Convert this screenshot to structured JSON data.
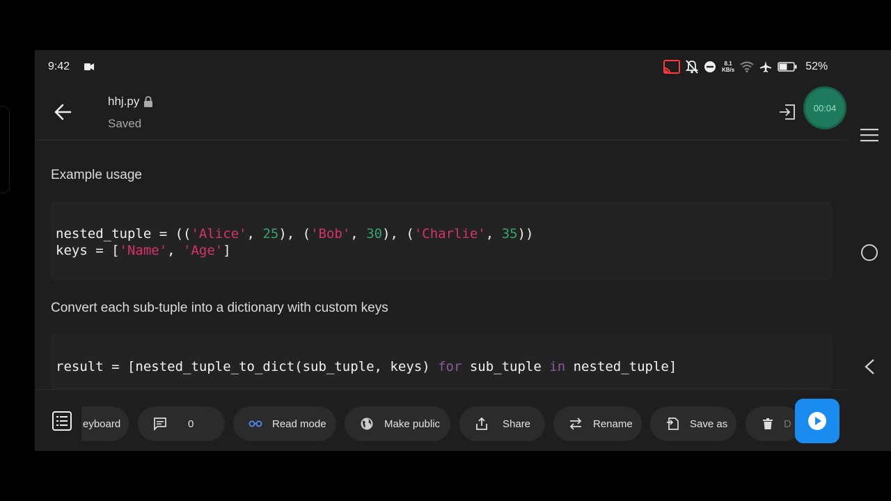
{
  "status_bar": {
    "time": "9:42",
    "net_speed_value": "8.1",
    "net_speed_unit": "KB/s",
    "battery": "52%"
  },
  "header": {
    "file_name": "hhj.py",
    "status": "Saved",
    "recording_time": "00:04"
  },
  "content": {
    "para1": "Example usage",
    "code1": {
      "line1": {
        "a": "nested_tuple = ((",
        "s1": "'Alice'",
        "b": ", ",
        "n1": "25",
        "c": "), (",
        "s2": "'Bob'",
        "d": ", ",
        "n2": "30",
        "e": "), (",
        "s3": "'Charlie'",
        "f": ", ",
        "n3": "35",
        "g": "))"
      },
      "line2": {
        "a": "keys = [",
        "s1": "'Name'",
        "b": ", ",
        "s2": "'Age'",
        "c": "]"
      }
    },
    "para2": "Convert each sub-tuple into a dictionary with custom keys",
    "code2": {
      "a": "result = [nested_tuple_to_dict(sub_tuple, keys) ",
      "k1": "for",
      "b": " sub_tuple ",
      "k2": "in",
      "c": " nested_tuple]"
    }
  },
  "toolbar": {
    "keyboard": "eyboard",
    "comments_count": "0",
    "read_mode": "Read mode",
    "make_public": "Make public",
    "share": "Share",
    "rename": "Rename",
    "save_as": "Save as",
    "delete": "D"
  },
  "colors": {
    "string": "#d6336c",
    "number": "#37a273",
    "keyword": "#8a5a9a",
    "run_button": "#1a8cf0",
    "record_badge": "#1e7a5c"
  }
}
